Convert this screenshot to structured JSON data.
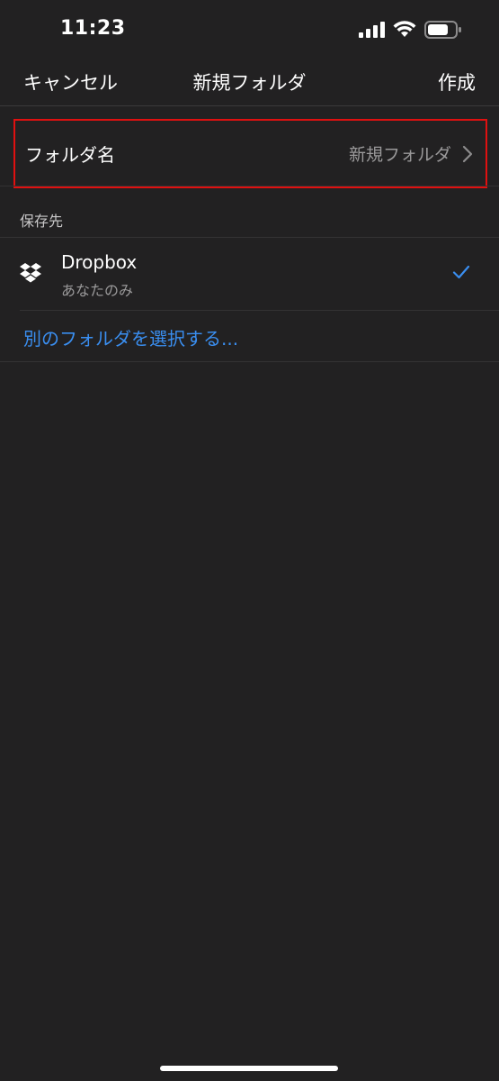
{
  "status_bar": {
    "time": "11:23",
    "icons": [
      "signal-icon",
      "wifi-icon",
      "battery-icon"
    ]
  },
  "nav": {
    "cancel_label": "キャンセル",
    "title": "新規フォルダ",
    "create_label": "作成"
  },
  "folder_name": {
    "label": "フォルダ名",
    "value": "新規フォルダ",
    "highlight_color": "#e01010"
  },
  "save_location": {
    "header": "保存先",
    "item": {
      "title": "Dropbox",
      "subtitle": "あなたのみ",
      "icon": "dropbox-icon",
      "selected": true
    },
    "other_folder_label": "別のフォルダを選択する..."
  },
  "colors": {
    "background": "#222122",
    "accent": "#3a8ef0",
    "secondary_text": "#9a999a"
  }
}
